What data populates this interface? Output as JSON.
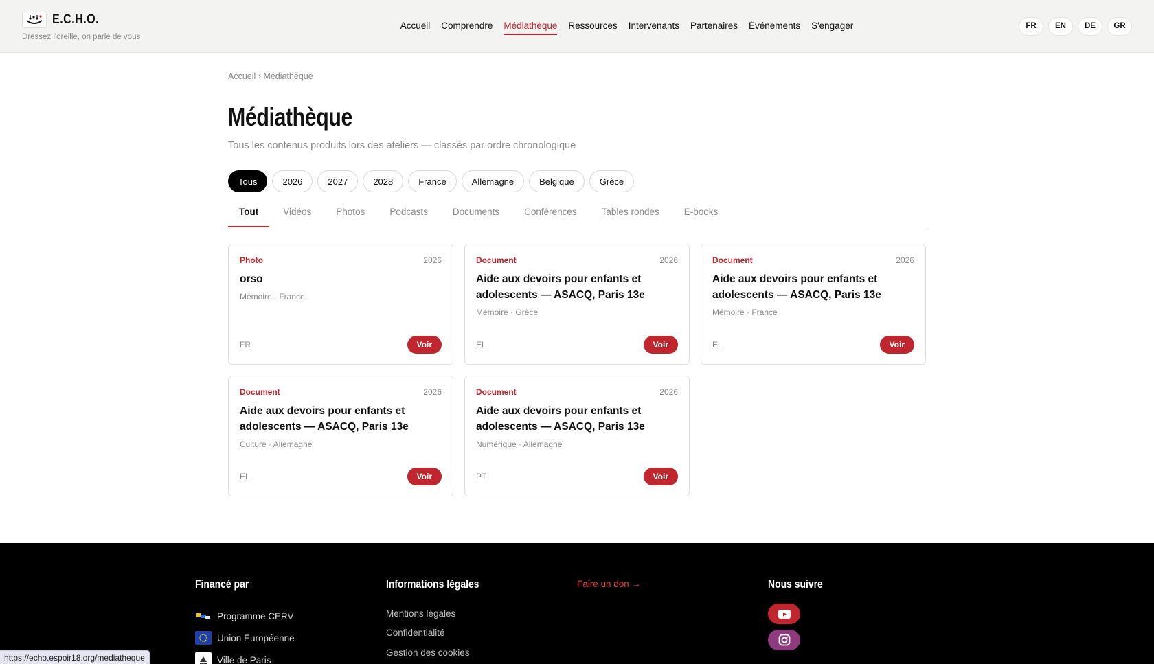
{
  "header": {
    "brand_name": "E.C.H.O.",
    "tagline": "Dressez l'oreille, on parle de vous",
    "nav": [
      {
        "label": "Accueil",
        "active": false
      },
      {
        "label": "Comprendre",
        "active": false
      },
      {
        "label": "Médiathèque",
        "active": true
      },
      {
        "label": "Ressources",
        "active": false
      },
      {
        "label": "Intervenants",
        "active": false
      },
      {
        "label": "Partenaires",
        "active": false
      },
      {
        "label": "Événements",
        "active": false
      },
      {
        "label": "S'engager",
        "active": false
      }
    ],
    "languages": [
      "FR",
      "EN",
      "DE",
      "GR"
    ]
  },
  "breadcrumb": "Accueil › Médiathèque",
  "page": {
    "title": "Médiathèque",
    "subtitle": "Tous les contenus produits lors des ateliers — classés par ordre chronologique"
  },
  "filters": [
    {
      "label": "Tous",
      "active": true
    },
    {
      "label": "2026",
      "active": false
    },
    {
      "label": "2027",
      "active": false
    },
    {
      "label": "2028",
      "active": false
    },
    {
      "label": "France",
      "active": false
    },
    {
      "label": "Allemagne",
      "active": false
    },
    {
      "label": "Belgique",
      "active": false
    },
    {
      "label": "Grèce",
      "active": false
    }
  ],
  "tabs": [
    {
      "label": "Tout",
      "active": true
    },
    {
      "label": "Vidéos",
      "active": false
    },
    {
      "label": "Photos",
      "active": false
    },
    {
      "label": "Podcasts",
      "active": false
    },
    {
      "label": "Documents",
      "active": false
    },
    {
      "label": "Conférences",
      "active": false
    },
    {
      "label": "Tables rondes",
      "active": false
    },
    {
      "label": "E-books",
      "active": false
    }
  ],
  "cards": [
    {
      "type": "Photo",
      "year": "2026",
      "title": "orso",
      "meta": "Mémoire · France",
      "lang": "FR",
      "action": "Voir"
    },
    {
      "type": "Document",
      "year": "2026",
      "title": "Aide aux devoirs pour enfants et adolescents — ASACQ, Paris 13e",
      "meta": "Mémoire · Grèce",
      "lang": "EL",
      "action": "Voir"
    },
    {
      "type": "Document",
      "year": "2026",
      "title": "Aide aux devoirs pour enfants et adolescents — ASACQ, Paris 13e",
      "meta": "Mémoire · France",
      "lang": "EL",
      "action": "Voir"
    },
    {
      "type": "Document",
      "year": "2026",
      "title": "Aide aux devoirs pour enfants et adolescents — ASACQ, Paris 13e",
      "meta": "Culture · Allemagne",
      "lang": "EL",
      "action": "Voir"
    },
    {
      "type": "Document",
      "year": "2026",
      "title": "Aide aux devoirs pour enfants et adolescents — ASACQ, Paris 13e",
      "meta": "Numérique · Allemagne",
      "lang": "PT",
      "action": "Voir"
    }
  ],
  "footer": {
    "funded_title": "Financé par",
    "funders": [
      {
        "label": "Programme CERV",
        "icon": "cerv-logo-icon"
      },
      {
        "label": "Union Européenne",
        "icon": "eu-flag-icon"
      },
      {
        "label": "Ville de Paris",
        "icon": "paris-logo-icon"
      }
    ],
    "legal_title": "Informations légales",
    "legal_links": [
      "Mentions légales",
      "Confidentialité",
      "Gestion des cookies"
    ],
    "donate": "Faire un don →",
    "follow_title": "Nous suivre",
    "social": [
      {
        "icon": "youtube-icon",
        "color": "#c0262d"
      },
      {
        "icon": "instagram-icon",
        "color": "#8e3a7e"
      }
    ]
  },
  "status_url": "https://echo.espoir18.org/mediatheque",
  "colors": {
    "accent": "#c0262d",
    "footer_bg": "#000000"
  }
}
